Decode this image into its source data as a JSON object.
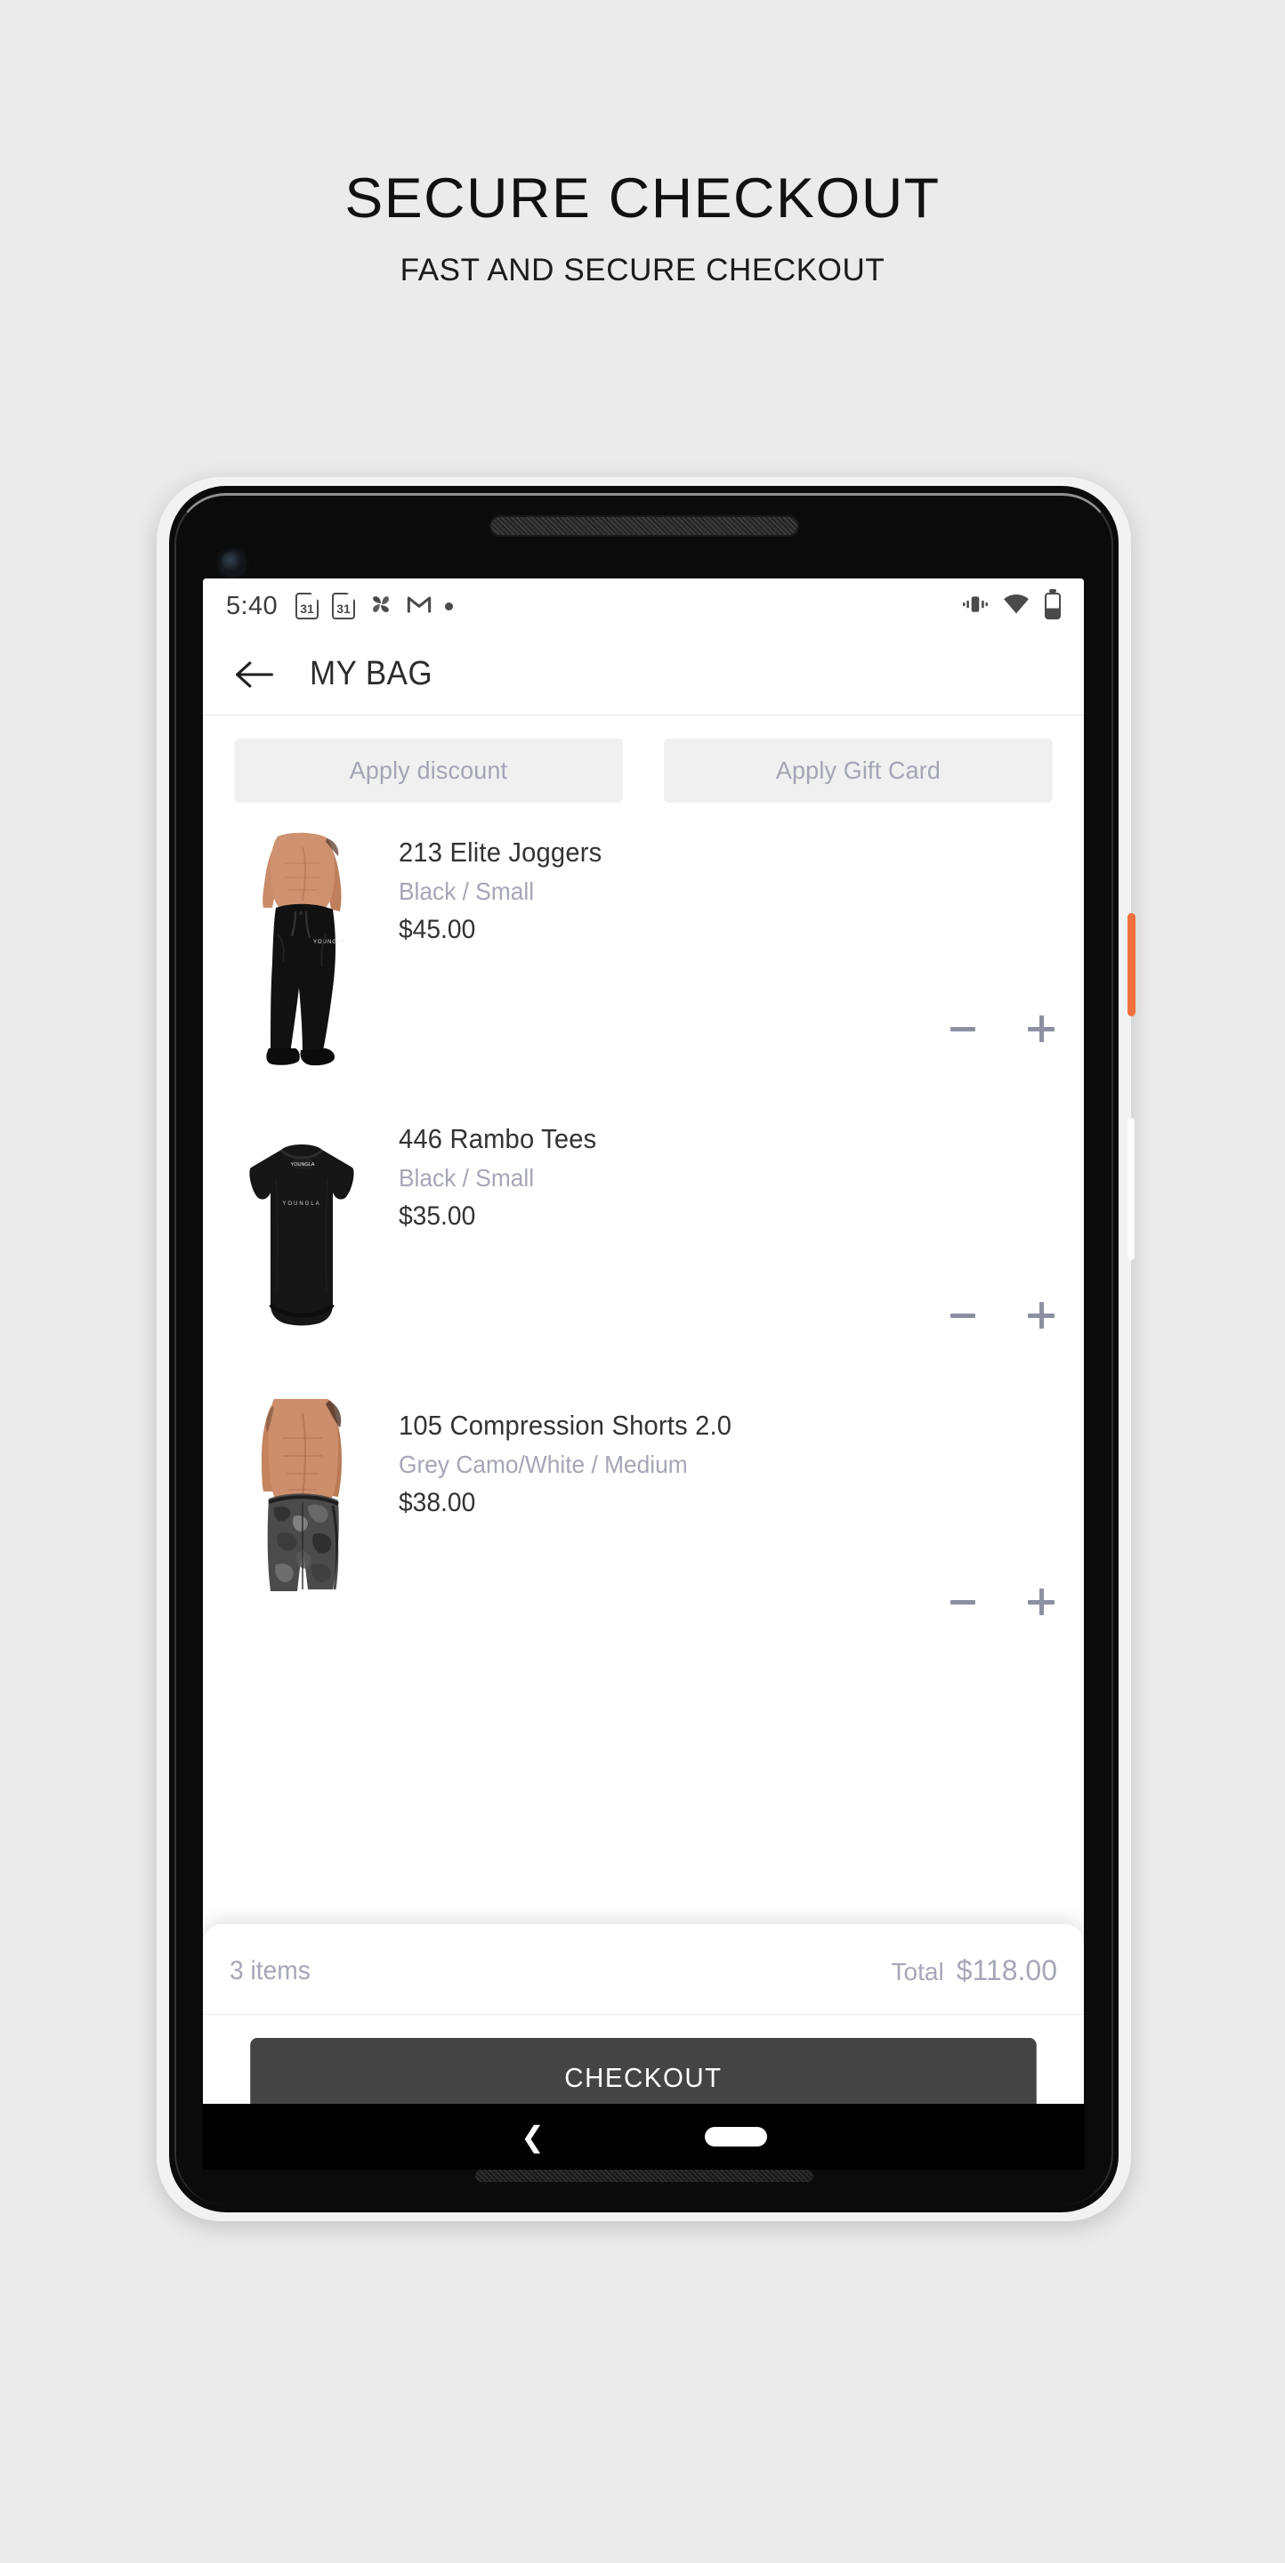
{
  "promo": {
    "title": "SECURE CHECKOUT",
    "subtitle": "FAST AND SECURE CHECKOUT"
  },
  "statusbar": {
    "time": "5:40",
    "calendar_1": "31",
    "calendar_2": "31",
    "icons": [
      "calendar-31-icon",
      "calendar-31-icon",
      "photos-pinwheel-icon",
      "gmail-icon",
      "dot-icon",
      "vibrate-icon",
      "wifi-icon",
      "battery-icon"
    ]
  },
  "appbar": {
    "title": "MY BAG",
    "back_icon": "back-arrow-icon"
  },
  "actions": {
    "discount_label": "Apply discount",
    "gift_card_label": "Apply Gift Card"
  },
  "cart": {
    "items": [
      {
        "title": "213 Elite Joggers",
        "variant": "Black / Small",
        "price": "$45.00",
        "thumb": "black-joggers-model-photo"
      },
      {
        "title": "446 Rambo Tees",
        "variant": "Black / Small",
        "price": "$35.00",
        "thumb": "black-tee-flatlay-photo"
      },
      {
        "title": "105 Compression Shorts 2.0",
        "variant": "Grey Camo/White / Medium",
        "price": "$38.00",
        "thumb": "grey-camo-shorts-model-photo"
      }
    ]
  },
  "summary": {
    "items_count": "3 items",
    "total_label": "Total",
    "total_value": "$118.00",
    "checkout_label": "CHECKOUT"
  },
  "colors": {
    "page_background": "#ebebeb",
    "muted_text": "#a5a7b6",
    "primary_text": "#333333",
    "checkout_button": "#444444",
    "chip_background": "#f0f0f0",
    "power_button": "#f2703c"
  }
}
